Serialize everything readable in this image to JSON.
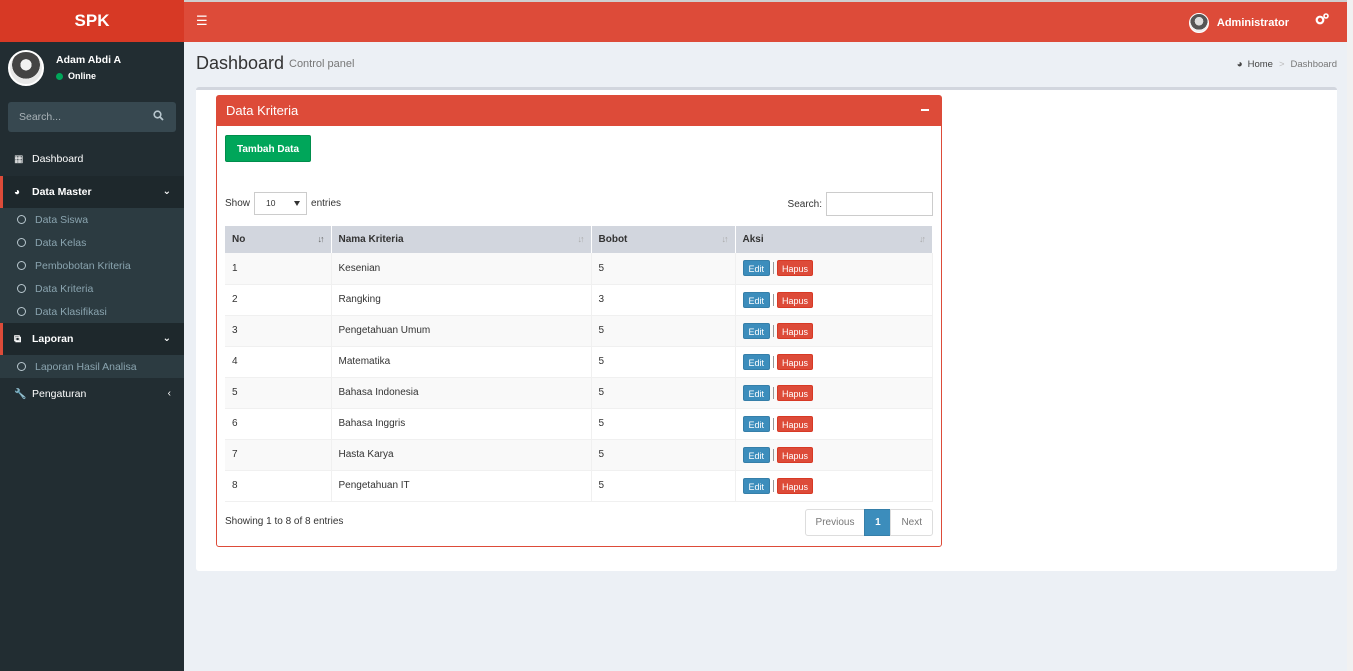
{
  "app": {
    "logo": "SPK"
  },
  "navbar": {
    "user_name": "Administrator"
  },
  "sidebar": {
    "user": {
      "name": "Adam Abdi A",
      "status": "Online"
    },
    "search_placeholder": "Search...",
    "items": [
      {
        "label": "Dashboard",
        "icon": "grid-icon"
      },
      {
        "label": "Data Master",
        "icon": "dashboard-icon",
        "chevron": "chevron-down-icon"
      },
      {
        "label": "Laporan",
        "icon": "copy-icon",
        "chevron": "chevron-down-icon"
      },
      {
        "label": "Pengaturan",
        "icon": "wrench-icon",
        "chevron": "chevron-left-icon"
      }
    ],
    "data_master_sub": [
      "Data Siswa",
      "Data Kelas",
      "Pembobotan Kriteria",
      "Data Kriteria",
      "Data Klasifikasi"
    ],
    "laporan_sub": [
      "Laporan Hasil Analisa"
    ]
  },
  "header": {
    "title": "Dashboard",
    "subtitle": "Control panel"
  },
  "breadcrumb": {
    "home": "Home",
    "current": "Dashboard"
  },
  "box": {
    "title": "Data Kriteria",
    "add_button": "Tambah Data",
    "show_label": "Show",
    "entries_label": "entries",
    "page_length": "10",
    "search_label": "Search:",
    "columns": [
      "No",
      "Nama Kriteria",
      "Bobot",
      "Aksi"
    ],
    "rows": [
      {
        "no": "1",
        "nama": "Kesenian",
        "bobot": "5"
      },
      {
        "no": "2",
        "nama": "Rangking",
        "bobot": "3"
      },
      {
        "no": "3",
        "nama": "Pengetahuan Umum",
        "bobot": "5"
      },
      {
        "no": "4",
        "nama": "Matematika",
        "bobot": "5"
      },
      {
        "no": "5",
        "nama": "Bahasa Indonesia",
        "bobot": "5"
      },
      {
        "no": "6",
        "nama": "Bahasa Inggris",
        "bobot": "5"
      },
      {
        "no": "7",
        "nama": "Hasta Karya",
        "bobot": "5"
      },
      {
        "no": "8",
        "nama": "Pengetahuan IT",
        "bobot": "5"
      }
    ],
    "edit_label": "Edit",
    "delete_label": "Hapus",
    "info": "Showing 1 to 8 of 8 entries",
    "pager": {
      "previous": "Previous",
      "current": "1",
      "next": "Next"
    }
  },
  "colors": {
    "brand": "#dd4b39",
    "sidebar": "#222d32",
    "success": "#00a65a",
    "primary": "#3c8dbc"
  }
}
